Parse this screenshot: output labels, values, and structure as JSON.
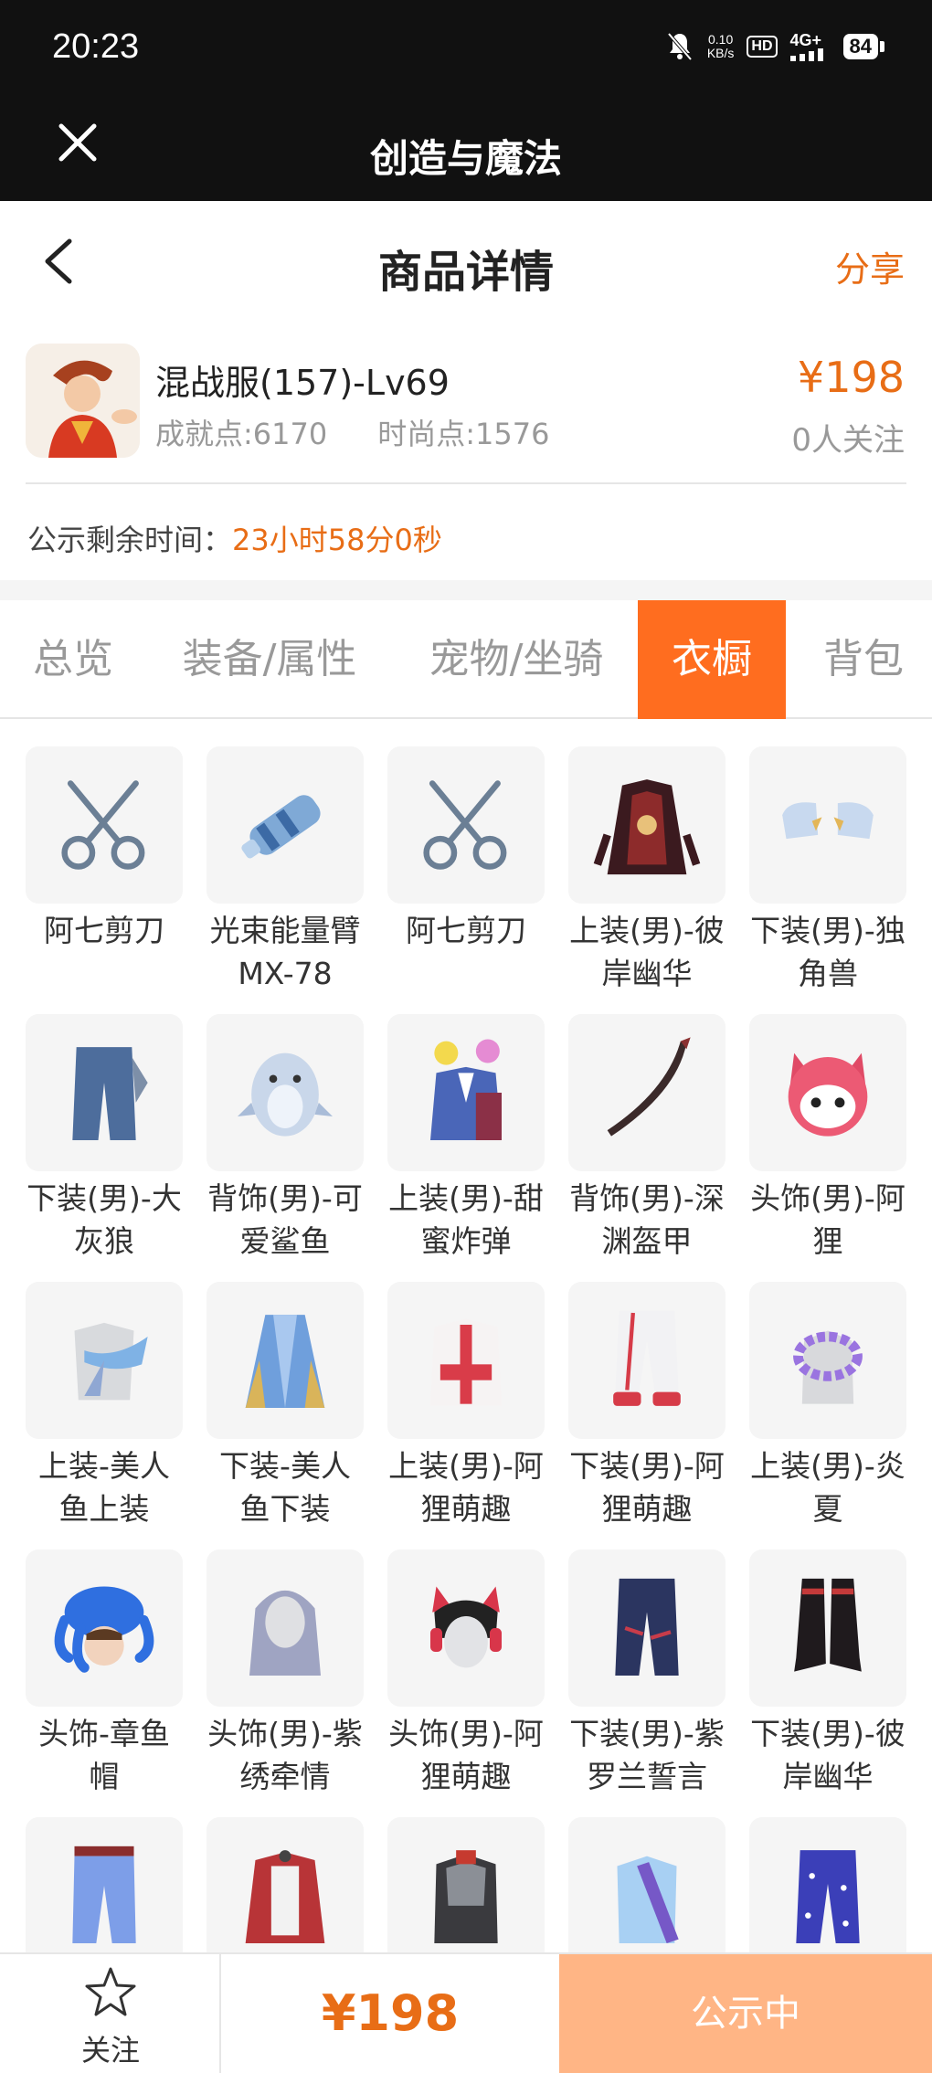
{
  "status_bar": {
    "time": "20:23",
    "net_speed_value": "0.10",
    "net_speed_unit": "KB/s",
    "hd": "HD",
    "network": "4G+",
    "battery": "84"
  },
  "top_bar": {
    "title": "创造与魔法"
  },
  "header": {
    "title": "商品详情",
    "share": "分享"
  },
  "product": {
    "name": "混战服(157)-Lv69",
    "achievement": "成就点:6170",
    "fashion": "时尚点:1576",
    "price": "¥198",
    "followers": "0人关注"
  },
  "notice": {
    "label": "公示剩余时间：",
    "countdown": "23小时58分0秒"
  },
  "tabs": [
    {
      "label": "总览"
    },
    {
      "label": "装备/属性"
    },
    {
      "label": "宠物/坐骑"
    },
    {
      "label": "衣橱",
      "active": true
    },
    {
      "label": "背包"
    }
  ],
  "items": [
    {
      "line1": "阿七剪刀",
      "line2": "",
      "icon": "scissors-icon"
    },
    {
      "line1": "光束能量臂",
      "line2": "MX-78",
      "icon": "arm-cannon-icon"
    },
    {
      "line1": "阿七剪刀",
      "line2": "",
      "icon": "scissors-icon"
    },
    {
      "line1": "上装(男)-彼",
      "line2": "岸幽华",
      "icon": "robe-icon"
    },
    {
      "line1": "下装(男)-独",
      "line2": "角兽",
      "icon": "boots-icon"
    },
    {
      "line1": "下装(男)-大",
      "line2": "灰狼",
      "icon": "pants-icon"
    },
    {
      "line1": "背饰(男)-可",
      "line2": "爱鲨鱼",
      "icon": "shark-icon"
    },
    {
      "line1": "上装(男)-甜",
      "line2": "蜜炸弹",
      "icon": "suit-icon"
    },
    {
      "line1": "背饰(男)-深",
      "line2": "渊盔甲",
      "icon": "blade-icon"
    },
    {
      "line1": "头饰(男)-阿",
      "line2": "狸",
      "icon": "fox-head-icon"
    },
    {
      "line1": "上装-美人",
      "line2": "鱼上装",
      "icon": "mermaid-top-icon"
    },
    {
      "line1": "下装-美人",
      "line2": "鱼下装",
      "icon": "mermaid-skirt-icon"
    },
    {
      "line1": "上装(男)-阿",
      "line2": "狸萌趣",
      "icon": "hoodie-icon"
    },
    {
      "line1": "下装(男)-阿",
      "line2": "狸萌趣",
      "icon": "white-pants-icon"
    },
    {
      "line1": "上装(男)-炎",
      "line2": "夏",
      "icon": "lei-icon"
    },
    {
      "line1": "头饰-章鱼",
      "line2": "帽",
      "icon": "octopus-hat-icon"
    },
    {
      "line1": "头饰(男)-紫",
      "line2": "绣牵情",
      "icon": "long-hair-icon"
    },
    {
      "line1": "头饰(男)-阿",
      "line2": "狸萌趣",
      "icon": "cat-ear-hair-icon"
    },
    {
      "line1": "下装(男)-紫",
      "line2": "罗兰誓言",
      "icon": "jeans-icon"
    },
    {
      "line1": "下装(男)-彼",
      "line2": "岸幽华",
      "icon": "black-boots-icon"
    },
    {
      "line1": "",
      "line2": "",
      "icon": "blue-pants-icon"
    },
    {
      "line1": "",
      "line2": "",
      "icon": "red-cape-icon"
    },
    {
      "line1": "",
      "line2": "",
      "icon": "armor-icon"
    },
    {
      "line1": "",
      "line2": "",
      "icon": "blue-top-icon"
    },
    {
      "line1": "",
      "line2": "",
      "icon": "star-pants-icon"
    }
  ],
  "bottom_bar": {
    "follow": "关注",
    "price": "¥198",
    "status": "公示中"
  },
  "colors": {
    "accent": "#e86d16",
    "tab_active": "#ff6d1f",
    "status_button": "#ffb585"
  }
}
